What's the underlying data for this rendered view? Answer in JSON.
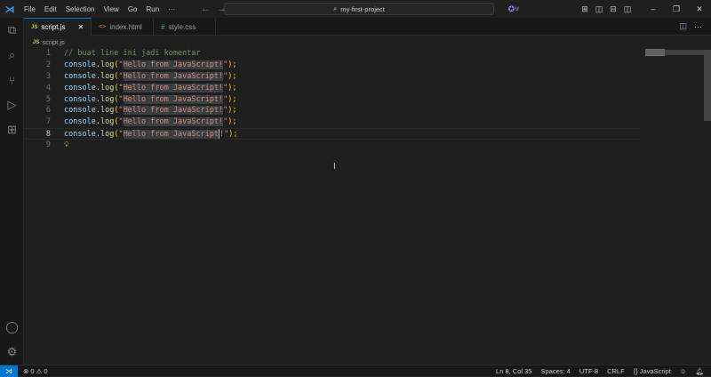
{
  "menu": [
    "File",
    "Edit",
    "Selection",
    "View",
    "Go",
    "Run",
    "···"
  ],
  "search": "my-first-project",
  "tabs": [
    {
      "label": "script.js",
      "icon": "JS"
    },
    {
      "label": "index.html",
      "icon": "<>"
    },
    {
      "label": "style.css",
      "icon": "#"
    }
  ],
  "breadcrumb": {
    "icon": "JS",
    "file": "script.js"
  },
  "editor": {
    "comment": "// buat line ini jadi komentar",
    "obj": "console",
    "dot": ".",
    "fn": "log",
    "open": "(",
    "quote": "\"",
    "string": "Hello from JavaScript",
    "bang": "!",
    "close": ");",
    "line_numbers": [
      "1",
      "2",
      "3",
      "4",
      "5",
      "6",
      "7",
      "8",
      "9"
    ]
  },
  "status": {
    "errors": "⊗ 0 ⚠ 0",
    "position": "Ln 8, Col 35",
    "spaces": "Spaces: 4",
    "encoding": "UTF-8",
    "eol": "CRLF",
    "language": "{} JavaScript"
  }
}
